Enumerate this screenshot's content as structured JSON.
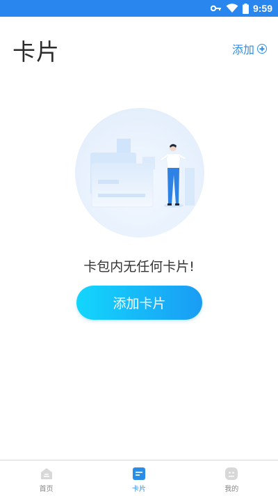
{
  "status_bar": {
    "time": "9:59",
    "color": "#2a86ef",
    "icons": [
      "key-icon",
      "wifi-icon",
      "battery-icon"
    ]
  },
  "header": {
    "title": "卡片",
    "add_label": "添加",
    "add_icon": "plus-circle-icon"
  },
  "empty_state": {
    "illustration": "empty-card-illustration",
    "message": "卡包内无任何卡片!"
  },
  "add_card_button": {
    "label": "添加卡片"
  },
  "bottom_nav": {
    "items": [
      {
        "label": "首页",
        "icon": "home-icon",
        "active": false
      },
      {
        "label": "卡片",
        "icon": "card-icon",
        "active": true
      },
      {
        "label": "我的",
        "icon": "profile-icon",
        "active": false
      }
    ]
  },
  "colors": {
    "accent": "#2a8ee9",
    "button_gradient_start": "#13d6fc",
    "button_gradient_end": "#1a9cf4"
  }
}
